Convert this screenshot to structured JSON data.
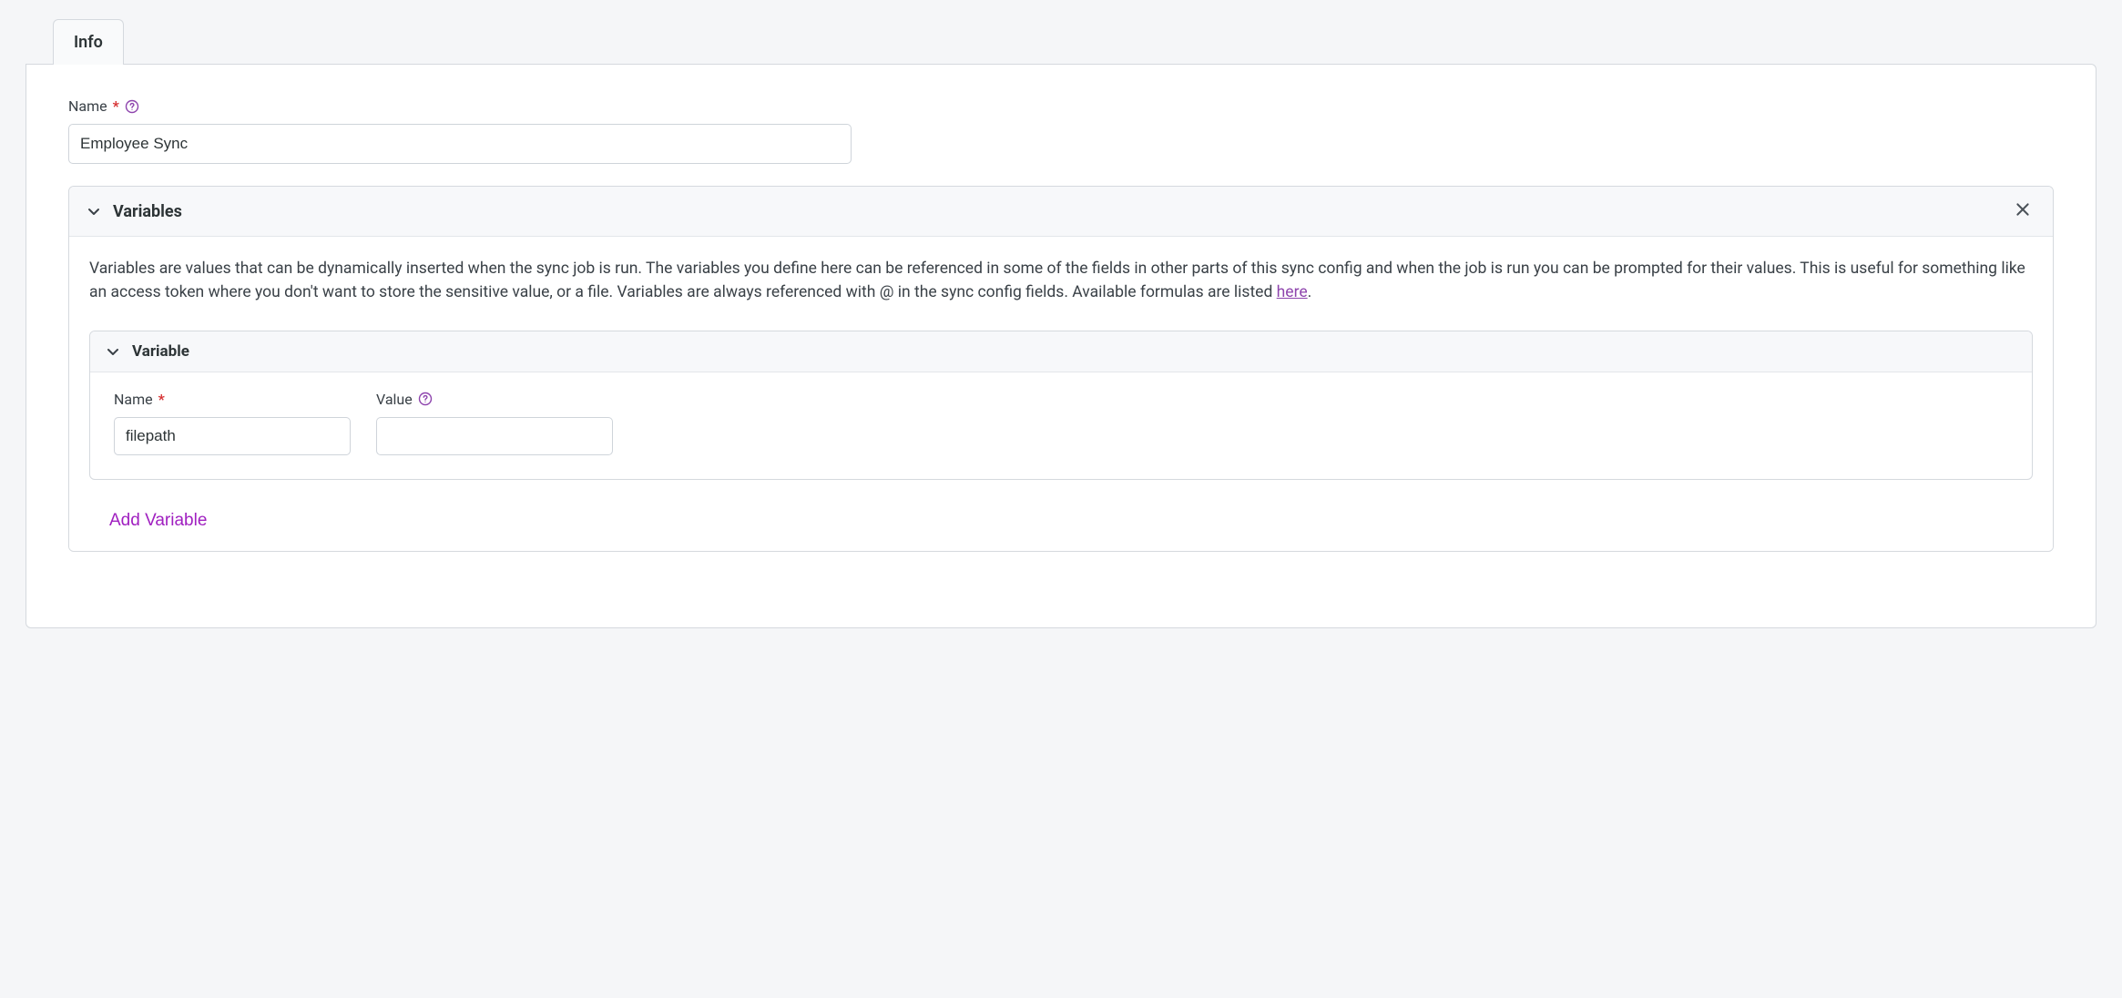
{
  "tab": {
    "label": "Info"
  },
  "form": {
    "name_label": "Name",
    "name_value": "Employee Sync"
  },
  "variables_section": {
    "title": "Variables",
    "description_prefix": "Variables are values that can be dynamically inserted when the sync job is run. The variables you define here can be referenced in some of the fields in other parts of this sync config and when the job is run you can be prompted for their values. This is useful for something like an access token where you don't want to store the sensitive value, or a file. Variables are always referenced with @ in the sync config fields. Available formulas are listed ",
    "description_link": "here",
    "description_suffix": ".",
    "item": {
      "title": "Variable",
      "name_label": "Name",
      "name_value": "filepath",
      "value_label": "Value",
      "value_value": ""
    },
    "add_label": "Add Variable"
  },
  "required_marker": "*"
}
